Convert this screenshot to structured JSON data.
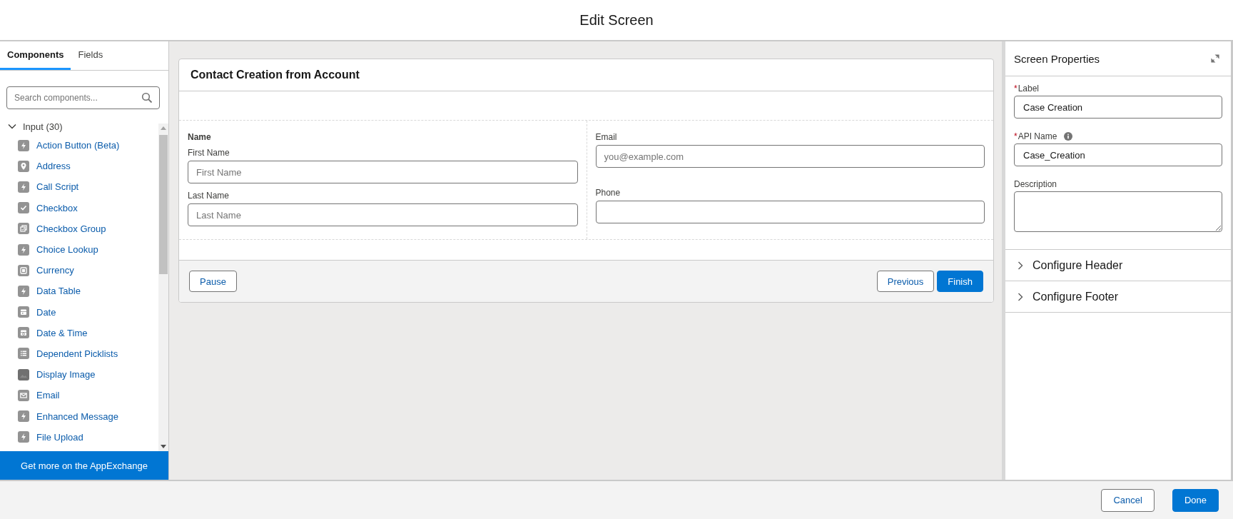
{
  "modal": {
    "title": "Edit Screen"
  },
  "palette": {
    "tabs": [
      {
        "label": "Components",
        "selected": true
      },
      {
        "label": "Fields",
        "selected": false
      }
    ],
    "search": {
      "placeholder": "Search components..."
    },
    "groups": [
      {
        "label": "Input (30)",
        "expanded": true,
        "children": [
          {
            "label": "Action Button (Beta)",
            "kind": "lightning"
          },
          {
            "label": "Address",
            "kind": "pin"
          },
          {
            "label": "Call Script",
            "kind": "lightning"
          },
          {
            "label": "Checkbox",
            "kind": "check"
          },
          {
            "label": "Checkbox Group",
            "kind": "checkgroup"
          },
          {
            "label": "Choice Lookup",
            "kind": "lightning"
          },
          {
            "label": "Currency",
            "kind": "currency"
          },
          {
            "label": "Data Table",
            "kind": "lightning"
          },
          {
            "label": "Date",
            "kind": "calendar"
          },
          {
            "label": "Date & Time",
            "kind": "calendartime"
          },
          {
            "label": "Dependent Picklists",
            "kind": "list"
          },
          {
            "label": "Display Image",
            "kind": "image"
          },
          {
            "label": "Email",
            "kind": "envelope"
          },
          {
            "label": "Enhanced Message",
            "kind": "lightning"
          },
          {
            "label": "File Upload",
            "kind": "lightning"
          }
        ]
      }
    ],
    "appexchange_link": "Get more on the AppExchange"
  },
  "canvas": {
    "screen_title": "Contact Creation from Account",
    "columns": [
      {
        "fields": [
          {
            "kind": "heading",
            "label": "Name"
          },
          {
            "kind": "input",
            "label": "First Name",
            "placeholder": "First Name"
          },
          {
            "kind": "input",
            "label": "Last Name",
            "placeholder": "Last Name"
          }
        ]
      },
      {
        "fields": [
          {
            "kind": "input",
            "label": "Email",
            "placeholder": "you@example.com"
          },
          {
            "kind": "input",
            "label": "Phone"
          }
        ]
      }
    ],
    "footer_buttons": {
      "left": [
        {
          "label": "Pause",
          "kind": "neutral"
        }
      ],
      "right": [
        {
          "label": "Previous",
          "kind": "neutral"
        },
        {
          "label": "Finish",
          "kind": "brand"
        }
      ]
    }
  },
  "properties": {
    "title": "Screen Properties",
    "fields": [
      {
        "kind": "text",
        "label": "Label",
        "required_mark": "*",
        "value": "Case Creation"
      },
      {
        "kind": "text",
        "label": "API Name",
        "required_mark": "*",
        "value": "Case_Creation",
        "info": true
      },
      {
        "kind": "textarea",
        "label": "Description"
      }
    ],
    "sections": [
      {
        "label": "Configure Header",
        "expanded": false
      },
      {
        "label": "Configure Footer",
        "expanded": false
      }
    ]
  },
  "footer": {
    "buttons": [
      {
        "label": "Cancel",
        "kind": "neutral"
      },
      {
        "label": "Done",
        "kind": "brand"
      }
    ]
  }
}
